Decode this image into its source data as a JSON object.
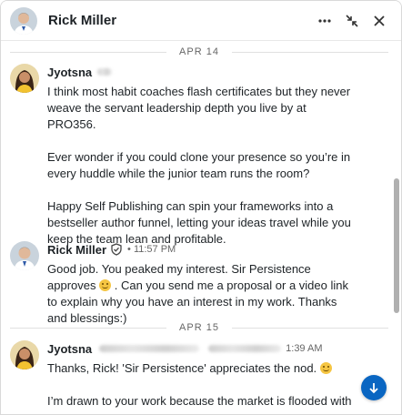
{
  "header": {
    "contact_name": "Rick Miller",
    "icons": [
      "more-icon",
      "collapse-icon",
      "close-icon"
    ]
  },
  "dividers": [
    "APR 14",
    "APR 15"
  ],
  "messages": [
    {
      "sender": "Jyotsna",
      "time": "",
      "paragraphs": [
        "I think most habit coaches flash certificates but they never weave the servant leadership depth you live by at PRO356.",
        "Ever wonder if you could clone your presence so you’re in every huddle while the junior team runs the room?",
        "Happy Self Publishing can spin your frameworks into a bestseller author funnel, letting your ideas travel while you keep the team lean and profitable."
      ]
    },
    {
      "sender": "Rick Miller",
      "time": "• 11:57 PM",
      "text_a": "Good job. You peaked my interest. Sir Persistence approves",
      "text_b": ". Can you send me a proposal or a video link to explain why you have an interest in my work. Thanks and blessings:)"
    },
    {
      "sender": "Jyotsna",
      "time": "1:39 AM",
      "text_a": "Thanks, Rick! 'Sir Persistence' appreciates the nod.",
      "text_b": "I’m drawn to your work because the market is flooded with"
    }
  ],
  "colors": {
    "accent": "#0a66c2",
    "text": "#1d2226",
    "muted": "#666666"
  }
}
